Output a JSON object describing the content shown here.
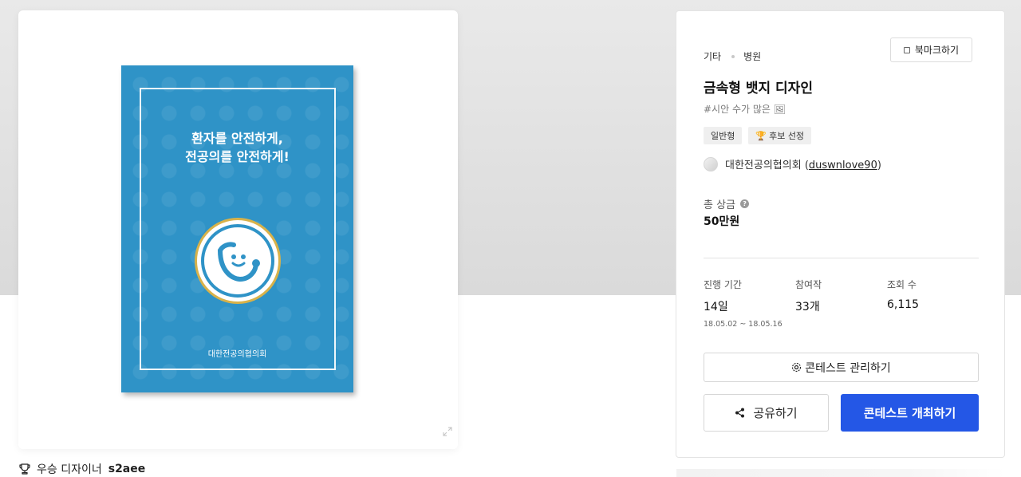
{
  "poster": {
    "headline_line1": "환자를 안전하게,",
    "headline_line2": "전공의를 안전하게!",
    "org": "대한전공의협의회",
    "background_color": "#2f93c7"
  },
  "winner": {
    "label": "우승 디자이너",
    "name": "s2aee",
    "icon": "trophy-icon"
  },
  "breadcrumb": [
    "기타",
    "병원"
  ],
  "bookmark_label": "북마크하기",
  "title": "금속형 뱃지 디자인",
  "hashtag": "#시안 수가 많은 🖼",
  "tags": [
    {
      "label": "일반형",
      "icon": ""
    },
    {
      "label": "후보 선정",
      "icon": "🏆"
    }
  ],
  "host": {
    "name": "대한전공의협의회",
    "handle": "duswnlove90"
  },
  "prize": {
    "label": "총 상금",
    "value": "50만원"
  },
  "stats": {
    "period": {
      "label": "진행 기간",
      "value": "14일",
      "sub": "18.05.02 ~ 18.05.16"
    },
    "participants": {
      "label": "참여작",
      "value": "33개"
    },
    "views": {
      "label": "조회 수",
      "value": "6,115"
    }
  },
  "buttons": {
    "manage": "콘테스트 관리하기",
    "share": "공유하기",
    "host": "콘테스트 개최하기"
  },
  "colors": {
    "accent": "#2457e6",
    "poster_blue": "#2f93c7"
  }
}
